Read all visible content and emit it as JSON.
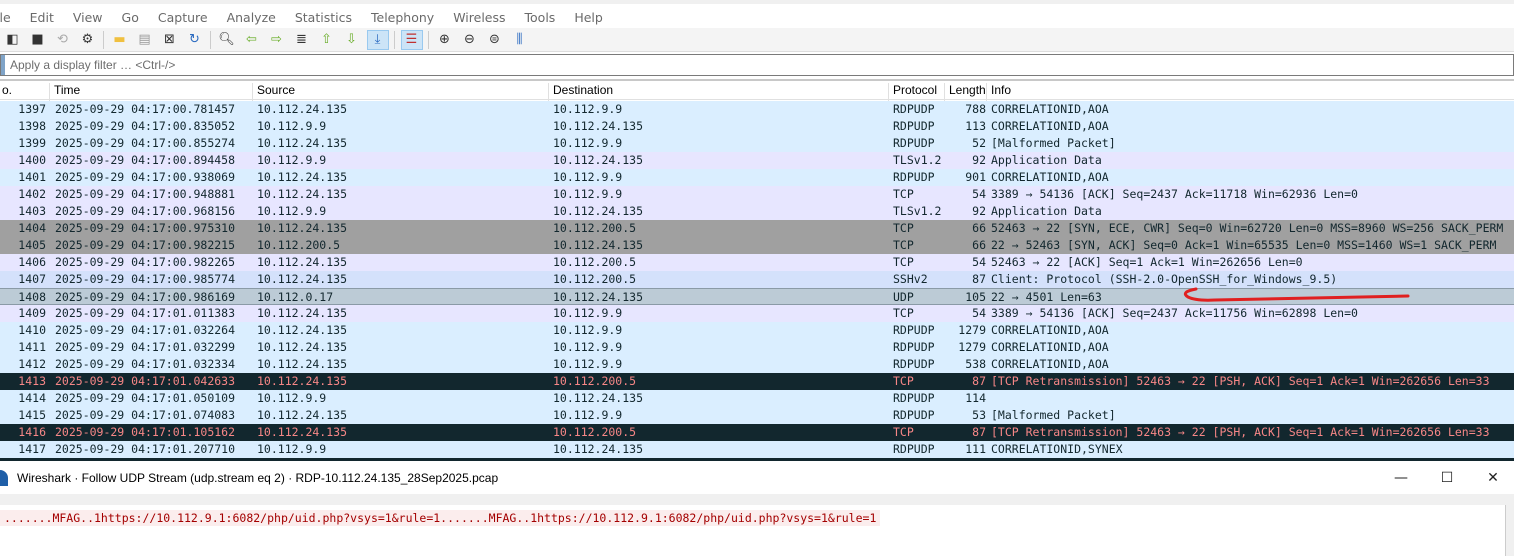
{
  "menu": [
    "ile",
    "Edit",
    "View",
    "Go",
    "Capture",
    "Analyze",
    "Statistics",
    "Telephony",
    "Wireless",
    "Tools",
    "Help"
  ],
  "filter": {
    "placeholder": "Apply a display filter … <Ctrl-/>"
  },
  "columns": [
    "o.",
    "Time",
    "Source",
    "Destination",
    "Protocol",
    "Length",
    "Info"
  ],
  "packets": [
    {
      "no": "1397",
      "time": "2025-09-29 04:17:00.781457",
      "src": "10.112.24.135",
      "dst": "10.112.9.9",
      "proto": "RDPUDP",
      "len": "788",
      "info": "CORRELATIONID,AOA",
      "style": "udp"
    },
    {
      "no": "1398",
      "time": "2025-09-29 04:17:00.835052",
      "src": "10.112.9.9",
      "dst": "10.112.24.135",
      "proto": "RDPUDP",
      "len": "113",
      "info": "CORRELATIONID,AOA",
      "style": "udp"
    },
    {
      "no": "1399",
      "time": "2025-09-29 04:17:00.855274",
      "src": "10.112.24.135",
      "dst": "10.112.9.9",
      "proto": "RDPUDP",
      "len": "52",
      "info": "[Malformed Packet]",
      "style": "udp"
    },
    {
      "no": "1400",
      "time": "2025-09-29 04:17:00.894458",
      "src": "10.112.9.9",
      "dst": "10.112.24.135",
      "proto": "TLSv1.2",
      "len": "92",
      "info": "Application Data",
      "style": "tcp"
    },
    {
      "no": "1401",
      "time": "2025-09-29 04:17:00.938069",
      "src": "10.112.24.135",
      "dst": "10.112.9.9",
      "proto": "RDPUDP",
      "len": "901",
      "info": "CORRELATIONID,AOA",
      "style": "udp"
    },
    {
      "no": "1402",
      "time": "2025-09-29 04:17:00.948881",
      "src": "10.112.24.135",
      "dst": "10.112.9.9",
      "proto": "TCP",
      "len": "54",
      "info": "3389 → 54136 [ACK] Seq=2437 Ack=11718 Win=62936 Len=0",
      "style": "tcp"
    },
    {
      "no": "1403",
      "time": "2025-09-29 04:17:00.968156",
      "src": "10.112.9.9",
      "dst": "10.112.24.135",
      "proto": "TLSv1.2",
      "len": "92",
      "info": "Application Data",
      "style": "tcp"
    },
    {
      "no": "1404",
      "time": "2025-09-29 04:17:00.975310",
      "src": "10.112.24.135",
      "dst": "10.112.200.5",
      "proto": "TCP",
      "len": "66",
      "info": "52463 → 22 [SYN, ECE, CWR] Seq=0 Win=62720 Len=0 MSS=8960 WS=256 SACK_PERM",
      "style": "syn"
    },
    {
      "no": "1405",
      "time": "2025-09-29 04:17:00.982215",
      "src": "10.112.200.5",
      "dst": "10.112.24.135",
      "proto": "TCP",
      "len": "66",
      "info": "22 → 52463 [SYN, ACK] Seq=0 Ack=1 Win=65535 Len=0 MSS=1460 WS=1 SACK_PERM",
      "style": "syn"
    },
    {
      "no": "1406",
      "time": "2025-09-29 04:17:00.982265",
      "src": "10.112.24.135",
      "dst": "10.112.200.5",
      "proto": "TCP",
      "len": "54",
      "info": "52463 → 22 [ACK] Seq=1 Ack=1 Win=262656 Len=0",
      "style": "tcp"
    },
    {
      "no": "1407",
      "time": "2025-09-29 04:17:00.985774",
      "src": "10.112.24.135",
      "dst": "10.112.200.5",
      "proto": "SSHv2",
      "len": "87",
      "info": "Client: Protocol (SSH-2.0-OpenSSH_for_Windows_9.5)",
      "style": "ssh"
    },
    {
      "no": "1408",
      "time": "2025-09-29 04:17:00.986169",
      "src": "10.112.0.17",
      "dst": "10.112.24.135",
      "proto": "UDP",
      "len": "105",
      "info": "22 → 4501 Len=63",
      "style": "sel"
    },
    {
      "no": "1409",
      "time": "2025-09-29 04:17:01.011383",
      "src": "10.112.24.135",
      "dst": "10.112.9.9",
      "proto": "TCP",
      "len": "54",
      "info": "3389 → 54136 [ACK] Seq=2437 Ack=11756 Win=62898 Len=0",
      "style": "tcp"
    },
    {
      "no": "1410",
      "time": "2025-09-29 04:17:01.032264",
      "src": "10.112.24.135",
      "dst": "10.112.9.9",
      "proto": "RDPUDP",
      "len": "1279",
      "info": "CORRELATIONID,AOA",
      "style": "udp"
    },
    {
      "no": "1411",
      "time": "2025-09-29 04:17:01.032299",
      "src": "10.112.24.135",
      "dst": "10.112.9.9",
      "proto": "RDPUDP",
      "len": "1279",
      "info": "CORRELATIONID,AOA",
      "style": "udp"
    },
    {
      "no": "1412",
      "time": "2025-09-29 04:17:01.032334",
      "src": "10.112.24.135",
      "dst": "10.112.9.9",
      "proto": "RDPUDP",
      "len": "538",
      "info": "CORRELATIONID,AOA",
      "style": "udp"
    },
    {
      "no": "1413",
      "time": "2025-09-29 04:17:01.042633",
      "src": "10.112.24.135",
      "dst": "10.112.200.5",
      "proto": "TCP",
      "len": "87",
      "info": "[TCP Retransmission] 52463 → 22 [PSH, ACK] Seq=1 Ack=1 Win=262656 Len=33",
      "style": "bad"
    },
    {
      "no": "1414",
      "time": "2025-09-29 04:17:01.050109",
      "src": "10.112.9.9",
      "dst": "10.112.24.135",
      "proto": "RDPUDP",
      "len": "114",
      "info": "",
      "style": "udp"
    },
    {
      "no": "1415",
      "time": "2025-09-29 04:17:01.074083",
      "src": "10.112.24.135",
      "dst": "10.112.9.9",
      "proto": "RDPUDP",
      "len": "53",
      "info": "[Malformed Packet]",
      "style": "udp"
    },
    {
      "no": "1416",
      "time": "2025-09-29 04:17:01.105162",
      "src": "10.112.24.135",
      "dst": "10.112.200.5",
      "proto": "TCP",
      "len": "87",
      "info": "[TCP Retransmission] 52463 → 22 [PSH, ACK] Seq=1 Ack=1 Win=262656 Len=33",
      "style": "bad"
    },
    {
      "no": "1417",
      "time": "2025-09-29 04:17:01.207710",
      "src": "10.112.9.9",
      "dst": "10.112.24.135",
      "proto": "RDPUDP",
      "len": "111",
      "info": "CORRELATIONID,SYNEX",
      "style": "udp"
    }
  ],
  "dialog": {
    "title": "Wireshark · Follow UDP Stream (udp.stream eq 2) · RDP-10.112.24.135_28Sep2025.pcap",
    "stream_text": ".......MFAG..1https://10.112.9.1:6082/php/uid.php?vsys=1&rule=1.......MFAG..1https://10.112.9.1:6082/php/uid.php?vsys=1&rule=1"
  },
  "colors": {
    "annotation": "#e02020",
    "retransmission_bg": "#12272e",
    "retransmission_fg": "#f78787"
  }
}
